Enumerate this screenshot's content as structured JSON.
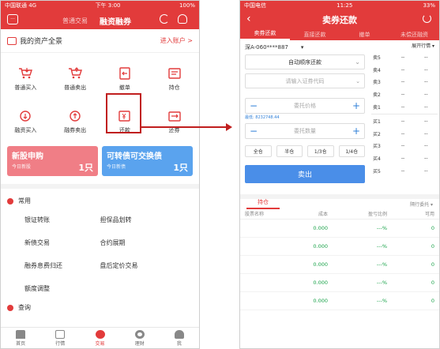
{
  "left": {
    "status": {
      "carrier": "中国联通 4G",
      "time": "下午 3:00",
      "battery": "100%"
    },
    "nav": {
      "tab_normal": "普通交易",
      "tab_margin": "融资融券"
    },
    "asset": {
      "title": "我的资产全景",
      "link": "进入账户 >"
    },
    "grid": [
      {
        "label": "普通买入",
        "icon": "cart-down-icon"
      },
      {
        "label": "普通卖出",
        "icon": "cart-up-icon"
      },
      {
        "label": "撤单",
        "icon": "undo-doc-icon"
      },
      {
        "label": "持仓",
        "icon": "holdings-icon"
      },
      {
        "label": "融资买入",
        "icon": "margin-buy-icon"
      },
      {
        "label": "融券卖出",
        "icon": "short-sell-icon"
      },
      {
        "label": "还款",
        "icon": "repay-icon"
      },
      {
        "label": "还券",
        "icon": "return-stock-icon"
      }
    ],
    "banners": [
      {
        "title": "新股申购",
        "sub": "今日新股",
        "count": "1只"
      },
      {
        "title": "可转债可交换债",
        "sub": "今日新债",
        "count": "1只"
      }
    ],
    "common": {
      "title": "常用",
      "links": [
        "银证转账",
        "担保品划转",
        "新债交易",
        "合约展期",
        "融券息费归还",
        "盘后定价交易",
        "额度调整"
      ]
    },
    "query": {
      "title": "查询"
    },
    "tabs": [
      "首页",
      "行情",
      "交易",
      "理财",
      "我"
    ]
  },
  "right": {
    "status": {
      "carrier": "中国电信",
      "time": "11:25",
      "battery": "33%"
    },
    "nav": {
      "title": "卖券还款"
    },
    "subtabs": [
      "卖券还款",
      "直接还款",
      "撤单",
      "未偿还融资"
    ],
    "account": {
      "market": "深A-060****887",
      "chevron": "▾"
    },
    "form": {
      "mode": "自动顺序还款",
      "code_placeholder": "请输入证券代码",
      "price_placeholder": "委托价格",
      "limit_text": "最低: 8232748.44",
      "qty_placeholder": "委托数量",
      "ratios": [
        "全仓",
        "半仓",
        "1/3仓",
        "1/4仓"
      ],
      "sell_label": "卖出"
    },
    "book": {
      "header": "展开行情 ▾",
      "sells": [
        "卖5",
        "卖4",
        "卖3",
        "卖2",
        "卖1"
      ],
      "buys": [
        "买1",
        "买2",
        "买3",
        "买4",
        "买5"
      ],
      "dash": "--"
    },
    "holdings": {
      "tab": "持仓",
      "filter": "隔行委托 ▾",
      "headers": [
        "股票名称",
        "成本",
        "盈亏比例",
        "可用"
      ],
      "rows": [
        {
          "name": "",
          "cost": "0.000",
          "pnl": "---%",
          "avail": "0"
        },
        {
          "name": "",
          "cost": "0.000",
          "pnl": "---%",
          "avail": "0"
        },
        {
          "name": "",
          "cost": "0.000",
          "pnl": "---%",
          "avail": "0"
        },
        {
          "name": "",
          "cost": "0.000",
          "pnl": "---%",
          "avail": "0"
        },
        {
          "name": "",
          "cost": "0.000",
          "pnl": "---%",
          "avail": "0"
        }
      ]
    }
  },
  "colors": {
    "brand_red": "#e23b3b",
    "button_blue": "#4a8ee8",
    "profit_green": "#1aa34a",
    "annotation": "#c01e1e"
  }
}
